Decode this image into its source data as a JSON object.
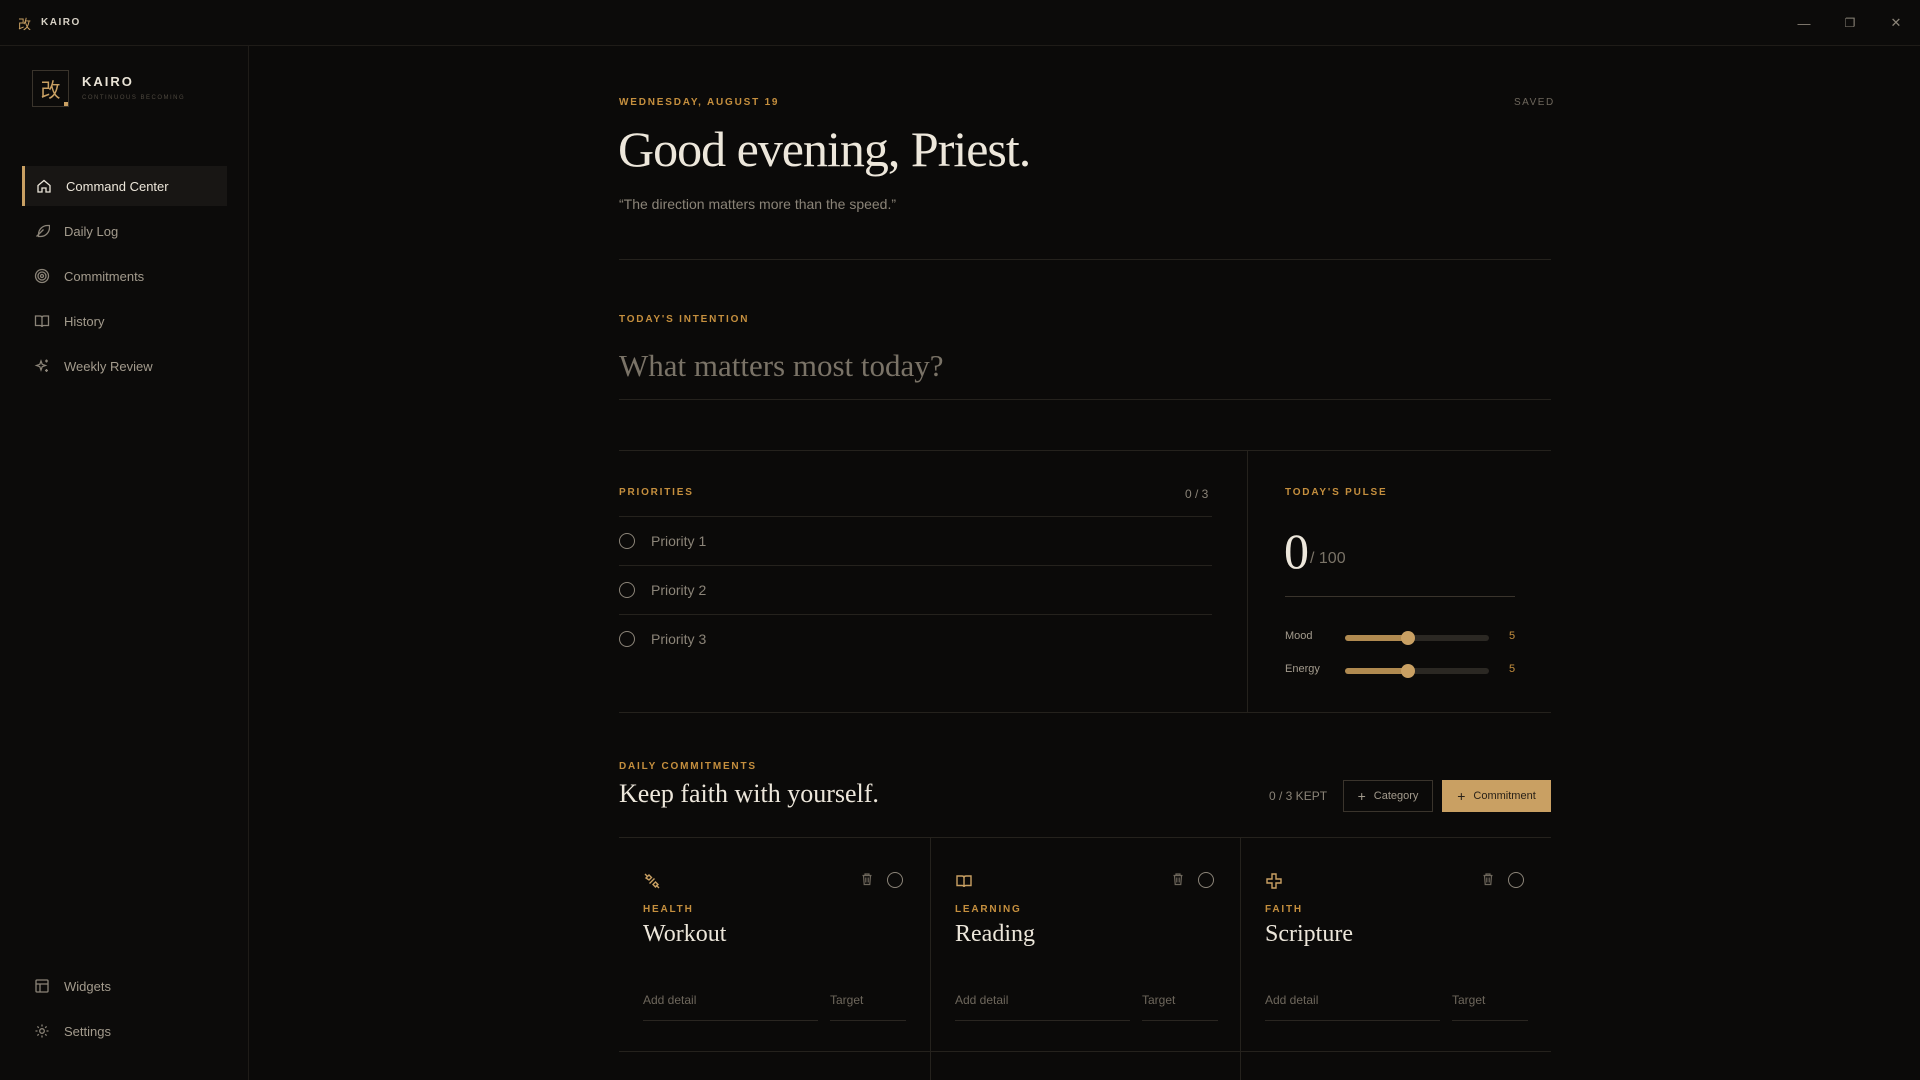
{
  "titlebar": {
    "app_glyph": "改",
    "app_name": "KAIRO",
    "minimize": "—",
    "maximize": "❐",
    "close": "✕"
  },
  "sidebar": {
    "logo_glyph": "改",
    "brand": "KAIRO",
    "tagline": "CONTINUOUS BECOMING",
    "items": [
      {
        "label": "Command Center",
        "icon": "home-icon",
        "active": true
      },
      {
        "label": "Daily Log",
        "icon": "feather-icon"
      },
      {
        "label": "Commitments",
        "icon": "target-icon"
      },
      {
        "label": "History",
        "icon": "book-icon"
      },
      {
        "label": "Weekly Review",
        "icon": "sparkle-icon"
      }
    ],
    "bottom_items": [
      {
        "label": "Widgets",
        "icon": "layout-icon"
      },
      {
        "label": "Settings",
        "icon": "gear-icon"
      }
    ]
  },
  "header": {
    "date": "WEDNESDAY, AUGUST 19",
    "save_status": "SAVED",
    "greeting": "Good evening, Priest.",
    "quote": "“The direction matters more than the speed.”"
  },
  "intention": {
    "label": "TODAY'S INTENTION",
    "placeholder": "What matters most today?"
  },
  "priorities": {
    "label": "PRIORITIES",
    "count": "0 / 3",
    "items": [
      "Priority 1",
      "Priority 2",
      "Priority 3"
    ]
  },
  "pulse": {
    "label": "TODAY'S PULSE",
    "score": "0",
    "max": "/ 100",
    "sliders": [
      {
        "label": "Mood",
        "value": "5",
        "fraction": 0.44
      },
      {
        "label": "Energy",
        "value": "5",
        "fraction": 0.44
      }
    ]
  },
  "commitments": {
    "label": "DAILY COMMITMENTS",
    "heading": "Keep faith with yourself.",
    "kept": "0 / 3 KEPT",
    "category_button": "Category",
    "commitment_button": "Commitment",
    "cards": [
      {
        "category": "HEALTH",
        "title": "Workout",
        "icon": "dumbbell-icon",
        "detail_placeholder": "Add detail",
        "target_placeholder": "Target"
      },
      {
        "category": "LEARNING",
        "title": "Reading",
        "icon": "book-open-icon",
        "detail_placeholder": "Add detail",
        "target_placeholder": "Target"
      },
      {
        "category": "FAITH",
        "title": "Scripture",
        "icon": "cross-icon",
        "detail_placeholder": "Add detail",
        "target_placeholder": "Target"
      }
    ]
  },
  "colors": {
    "accent": "#c9a063",
    "label_gold": "#c58f3e",
    "background": "#0b0a09"
  }
}
